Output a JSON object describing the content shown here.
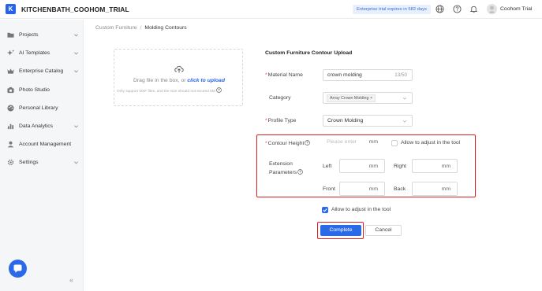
{
  "app": {
    "logo_letter": "K",
    "title": "KITCHENBATH_COOHOM_TRIAL"
  },
  "header": {
    "expire_text": "Enterprise trial expires in 582 days",
    "user_name": "Coohom Trial",
    "icons": [
      "globe-icon",
      "help-icon",
      "bell-icon",
      "avatar"
    ]
  },
  "sidebar": {
    "items": [
      {
        "label": "Projects",
        "icon": "folder-icon",
        "has_chevron": true
      },
      {
        "label": "AI Templates",
        "icon": "sparkle-icon",
        "has_chevron": true
      },
      {
        "label": "Enterprise Catalog",
        "icon": "crown-icon",
        "has_chevron": true
      },
      {
        "label": "Photo Studio",
        "icon": "camera-icon",
        "has_chevron": false
      },
      {
        "label": "Personal Library",
        "icon": "palette-icon",
        "has_chevron": false
      },
      {
        "label": "Data Analytics",
        "icon": "bar-chart-icon",
        "has_chevron": true
      },
      {
        "label": "Account Management",
        "icon": "user-icon",
        "has_chevron": false
      },
      {
        "label": "Settings",
        "icon": "gear-icon",
        "has_chevron": true
      }
    ],
    "collapse_label": "«"
  },
  "breadcrumb": {
    "parent": "Custom Furniture",
    "separator": "/",
    "current": "Molding Contours"
  },
  "upload": {
    "line1_prefix": "Drag file in the box,   or ",
    "line1_link": "click to upload",
    "line2": "Only support DXF files, and the size should not exceed 5M"
  },
  "form": {
    "title": "Custom Furniture Contour Upload",
    "material_name": {
      "label": "Material Name",
      "value": "crown molding",
      "counter": "13/50"
    },
    "category": {
      "label": "Category",
      "tag": "Array Crown Molding",
      "tag_close": "×"
    },
    "profile_type": {
      "label": "Profile Type",
      "value": "Crown Molding"
    },
    "contour_height": {
      "label": "Contour Height",
      "placeholder": "Please enter",
      "unit": "mm",
      "allow_label": "Allow to adjust in the tool",
      "allow_checked": false
    },
    "extension": {
      "label_line1": "Extension",
      "label_line2": "Parameters",
      "left": {
        "label": "Left",
        "unit": "mm"
      },
      "right": {
        "label": "Right",
        "unit": "mm"
      },
      "front": {
        "label": "Front",
        "unit": "mm"
      },
      "back": {
        "label": "Back",
        "unit": "mm"
      }
    },
    "allow_adjust": {
      "label": "Allow to adjust in the tool",
      "checked": true
    },
    "complete_label": "Complete",
    "cancel_label": "Cancel"
  },
  "colors": {
    "accent": "#2a6ae8",
    "highlight_border": "#e02020",
    "required": "#e23c3c"
  }
}
